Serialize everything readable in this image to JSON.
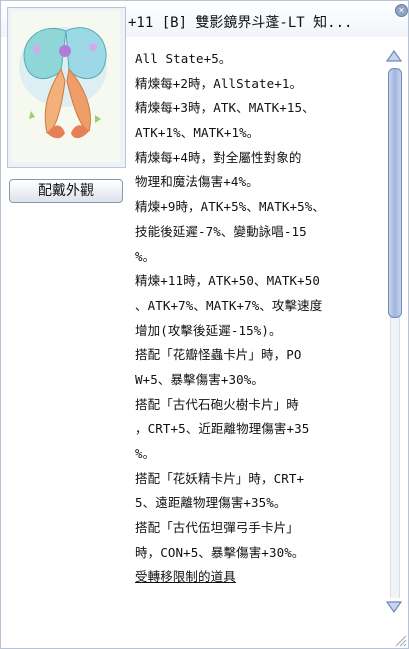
{
  "window": {
    "title": "+11 [B] 雙影鏡界斗蓬-LT 知...",
    "close_icon": "x-icon"
  },
  "item_image": {
    "icon": "butterfly-cloak-illustration"
  },
  "buttons": {
    "wear_appearance": "配戴外觀"
  },
  "description": {
    "lines": [
      "All State+5。",
      "精煉每+2時，AllState+1。",
      "精煉每+3時，ATK、MATK+15、",
      "ATK+1%、MATK+1%。",
      "精煉每+4時，對全屬性對象的",
      "物理和魔法傷害+4%。",
      "精煉+9時，ATK+5%、MATK+5%、",
      "技能後延遲-7%、變動詠唱-15",
      "%。",
      "精煉+11時，ATK+50、MATK+50",
      "、ATK+7%、MATK+7%、攻擊速度",
      "增加(攻擊後延遲-15%)。",
      "搭配「花瓣怪蟲卡片」時，PO",
      "W+5、暴擊傷害+30%。",
      "搭配「古代石砲火樹卡片」時",
      "，CRT+5、近距離物理傷害+35",
      "%。",
      "搭配「花妖精卡片」時，CRT+",
      "5、遠距離物理傷害+35%。",
      "搭配「古代伍坦彈弓手卡片」",
      "時，CON+5、暴擊傷害+30%。",
      "受轉移限制的道具"
    ]
  },
  "scroll": {
    "position_fraction": 0.0,
    "visible_fraction": 0.47
  },
  "colors": {
    "frame": "#b7c3d4",
    "scroll_accent": "#7f97c6"
  }
}
